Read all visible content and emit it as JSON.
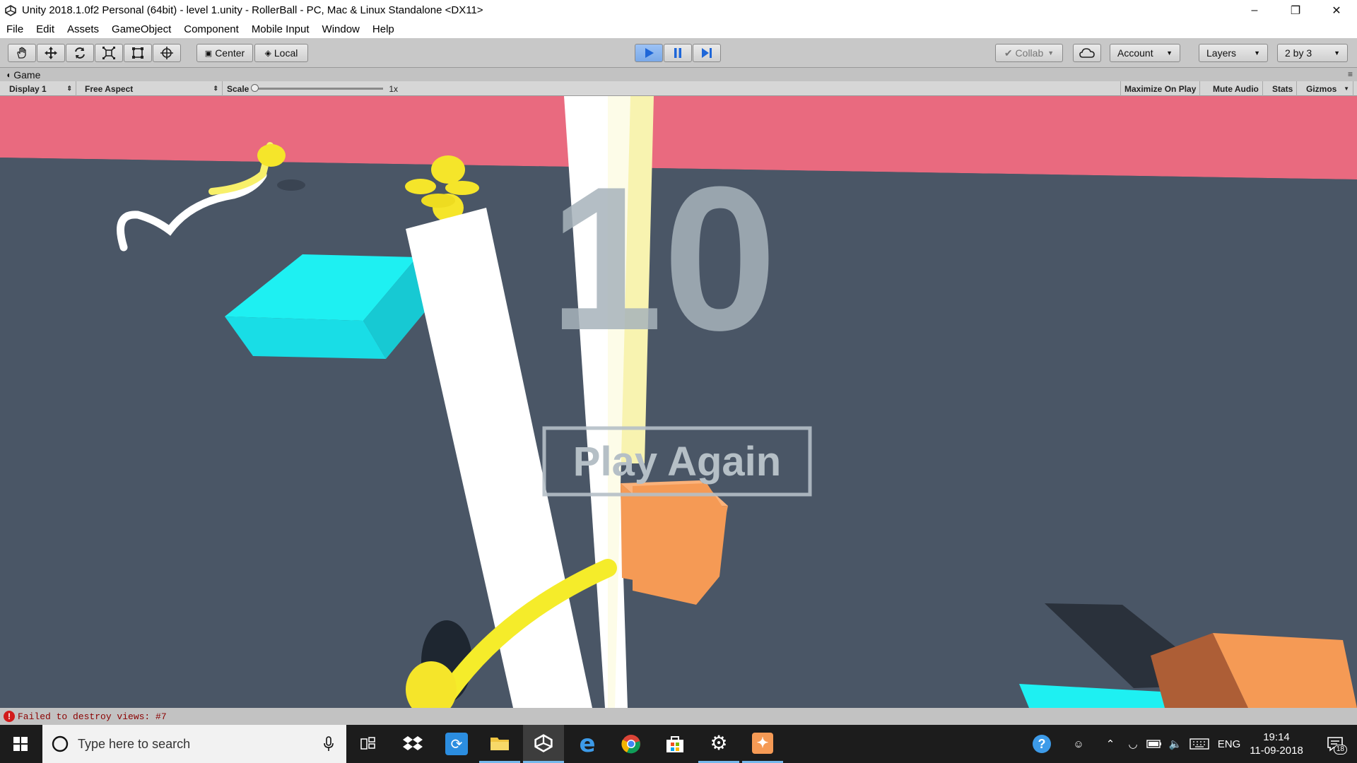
{
  "window": {
    "title": "Unity 2018.1.0f2 Personal (64bit) - level 1.unity - RollerBall - PC, Mac & Linux Standalone <DX11>",
    "controls": [
      "minimize-icon",
      "restore-icon",
      "close-icon"
    ]
  },
  "menu": {
    "items": [
      "File",
      "Edit",
      "Assets",
      "GameObject",
      "Component",
      "Mobile Input",
      "Window",
      "Help"
    ]
  },
  "toolbar": {
    "tools": [
      "hand-tool-icon",
      "move-tool-icon",
      "rotate-tool-icon",
      "scale-tool-icon",
      "rect-tool-icon",
      "transform-tool-icon"
    ],
    "pivot_label": "Center",
    "space_label": "Local",
    "play_icon": "play-icon",
    "pause_icon": "pause-icon",
    "step_icon": "step-icon",
    "collab_label": "Collab",
    "account_label": "Account",
    "layers_label": "Layers",
    "layout_label": "2 by 3",
    "play_active_color": "#3b82f6"
  },
  "game_view": {
    "tab_label": "Game",
    "display_label": "Display 1",
    "aspect_label": "Free Aspect",
    "scale_label": "Scale",
    "scale_value": "1x",
    "scale_fraction": 0.0,
    "maximize_label": "Maximize On Play",
    "mute_label": "Mute Audio",
    "stats_label": "Stats",
    "gizmos_label": "Gizmos"
  },
  "game": {
    "score_text": "10",
    "play_again_label": "Play Again",
    "colors": {
      "wall": "#e96a7f",
      "floor": "#4a5666",
      "cyan_block": "#1ef0f2",
      "orange_block": "#f59a55",
      "coin": "#f5e52a",
      "ui_gray": "#a7b3bb"
    }
  },
  "status": {
    "message": "Failed to destroy views: #7",
    "icon": "error-icon"
  },
  "taskbar": {
    "search_placeholder": "Type here to search",
    "pinned": [
      "task-view-icon",
      "dropbox-icon",
      "app-icon",
      "file-explorer-icon",
      "unity-icon",
      "edge-icon",
      "chrome-icon",
      "store-icon",
      "settings-icon",
      "app2-icon"
    ],
    "language": "ENG",
    "time": "19:14",
    "date": "11-09-2018",
    "notification_count": "18"
  }
}
